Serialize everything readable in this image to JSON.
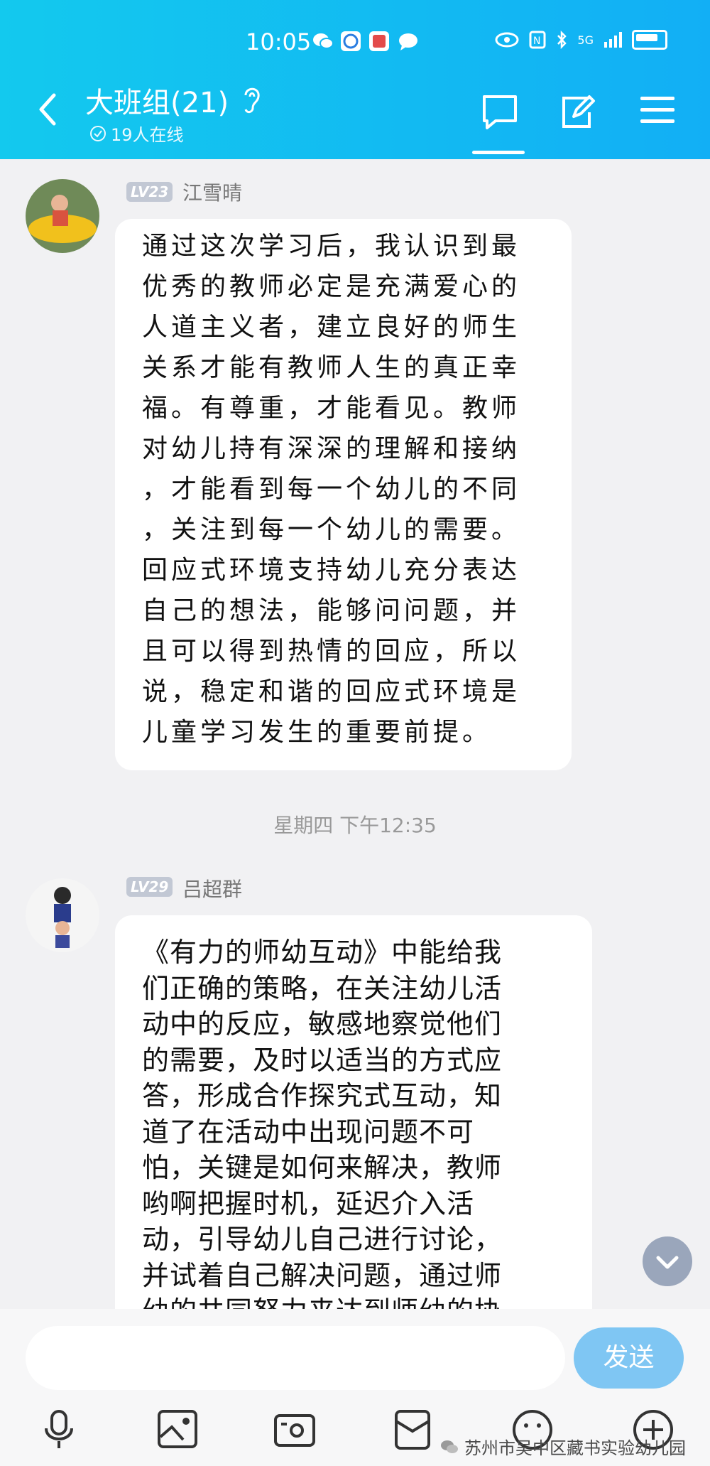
{
  "status_bar": {
    "time": "10:05",
    "network": "5G"
  },
  "header": {
    "title": "大班组(21)",
    "online": "19人在线"
  },
  "messages": [
    {
      "level": "LV23",
      "sender": "江雪晴",
      "text": "通过这次学习后，我认识到最\n优秀的教师必定是充满爱心的\n人道主义者，建立良好的师生\n关系才能有教师人生的真正幸\n福。有尊重，才能看见。教师\n对幼儿持有深深的理解和接纳\n，才能看到每一个幼儿的不同\n，关注到每一个幼儿的需要。\n回应式环境支持幼儿充分表达\n自己的想法，能够问问题，并\n且可以得到热情的回应，所以\n说，稳定和谐的回应式环境是\n儿童学习发生的重要前提。"
    },
    {
      "level": "LV29",
      "sender": "吕超群",
      "text": "《有力的师幼互动》中能给我\n们正确的策略，在关注幼儿活\n动中的反应，敏感地察觉他们\n的需要，及时以适当的方式应\n答，形成合作探究式互动，知\n道了在活动中出现问题不可\n怕，关键是如何来解决，教师\n哟啊把握时机，延迟介入活\n动，引导幼儿自己进行讨论，\n并试着自己解决问题，通过师\n幼的共同努力来达到师幼的协"
    }
  ],
  "timestamp": "星期四 下午12:35",
  "composer": {
    "send_label": "发送"
  },
  "watermark": "苏州市吴中区藏书实验幼儿园",
  "colors": {
    "header": "#12b8f2",
    "send": "#7fc6f3",
    "background": "#f1f1f3"
  }
}
